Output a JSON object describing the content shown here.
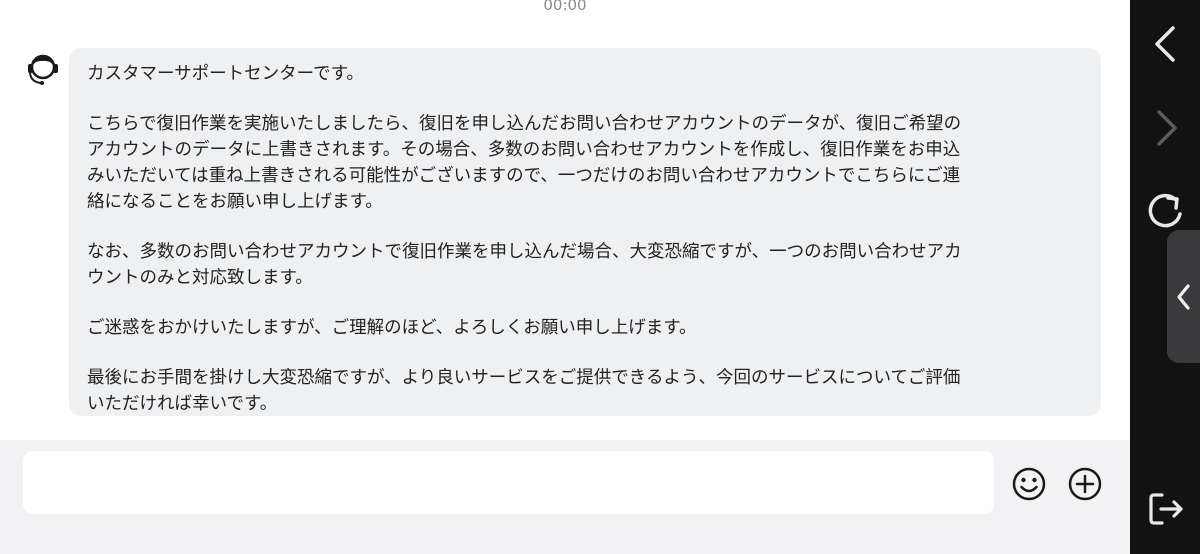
{
  "timestamp": "00:00",
  "message": {
    "paragraphs": [
      [
        "カスタマーサポートセンターです。"
      ],
      [
        "こちらで復旧作業を実施いたしましたら、復旧を申し込んだお問い合わせアカウントのデータが、復旧ご希望の",
        "アカウントのデータに上書きされます。その場合、多数のお問い合わせアカウントを作成し、復旧作業をお申込",
        "みいただいては重ね上書きされる可能性がございますので、一つだけのお問い合わせアカウントでこちらにご連",
        "絡になることをお願い申し上げます。"
      ],
      [
        "なお、多数のお問い合わせアカウントで復旧作業を申し込んだ場合、大変恐縮ですが、一つのお問い合わせアカ",
        "ウントのみと対応致します。"
      ],
      [
        "ご迷惑をおかけいたしますが、ご理解のほど、よろしくお願い申し上げます。"
      ],
      [
        "最後にお手間を掛けし大変恐縮ですが、より良いサービスをご提供できるよう、今回のサービスについてご評価",
        "いただければ幸いです。"
      ]
    ]
  },
  "input": {
    "value": "",
    "placeholder": ""
  },
  "icons": {
    "avatar": "headset-agent-icon",
    "emoji": "emoji-icon",
    "plus": "plus-circle-icon",
    "back": "chevron-left-icon",
    "forward": "chevron-right-icon",
    "reload": "reload-icon",
    "collapse": "chevron-left-small-icon",
    "exit": "exit-icon"
  },
  "colors": {
    "bubble": "#eff0f2",
    "panel": "#121212",
    "input_bar": "#f2f2f4",
    "text": "#222222"
  }
}
